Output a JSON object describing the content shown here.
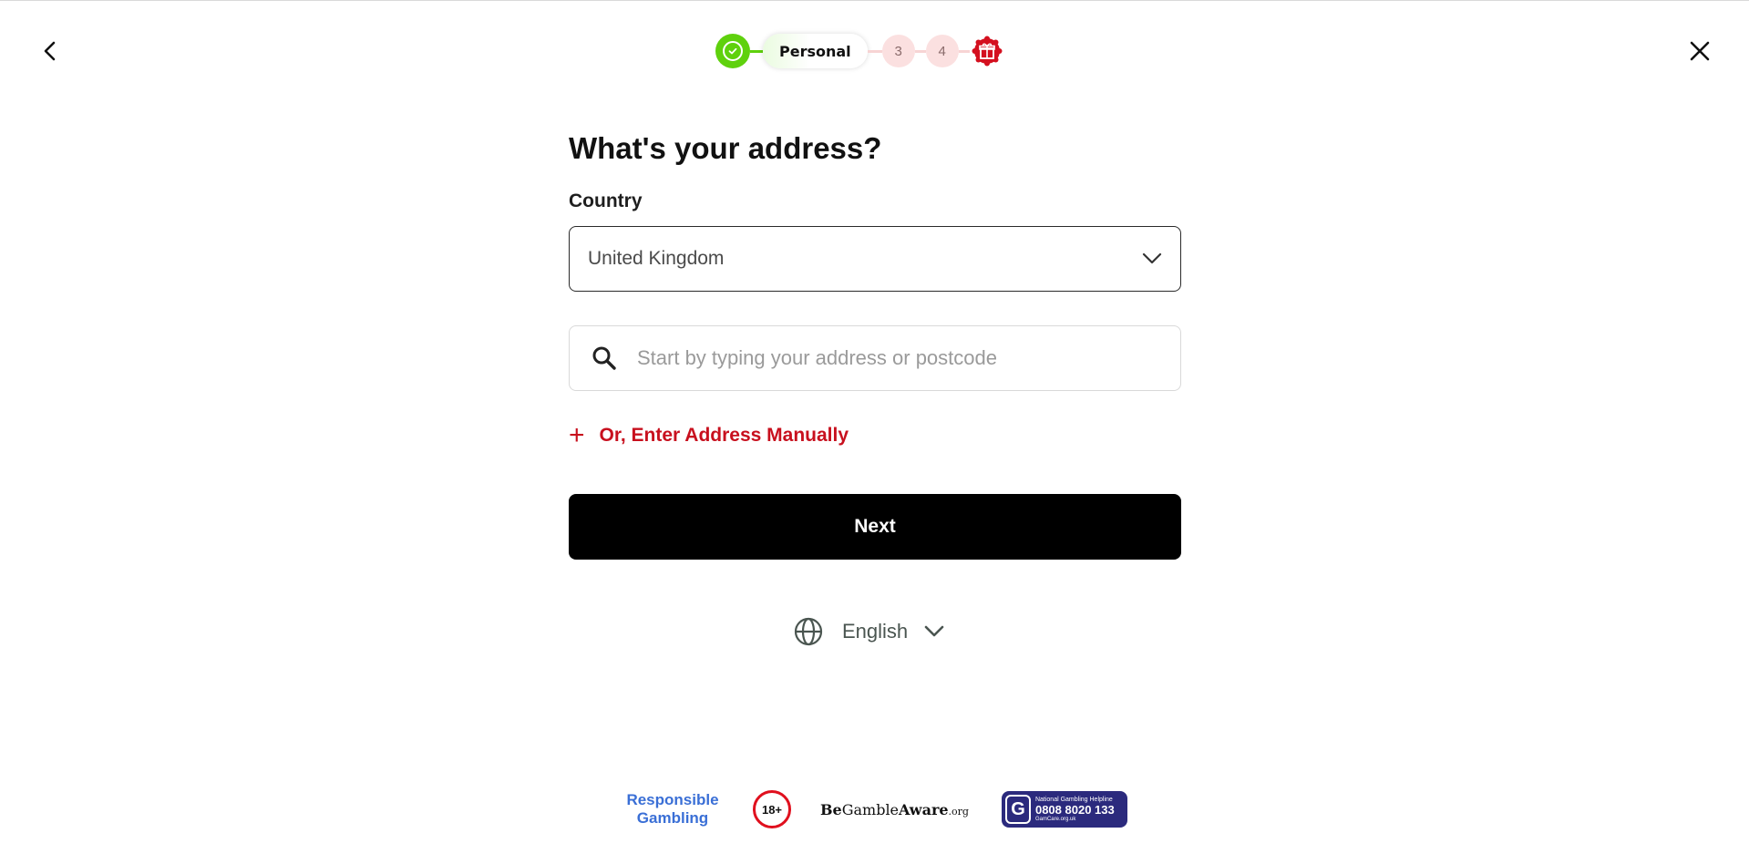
{
  "stepper": {
    "completed_icon": "check-icon",
    "current_label": "Personal",
    "steps": [
      "3",
      "4"
    ],
    "reward_icon": "gift-icon"
  },
  "nav": {
    "back_icon": "chevron-left-icon",
    "close_icon": "close-icon"
  },
  "form": {
    "heading": "What's your address?",
    "country_label": "Country",
    "country_value": "United Kingdom",
    "address_placeholder": "Start by typing your address or postcode",
    "manual_link_icon": "+",
    "manual_link_label": "Or, Enter Address Manually",
    "next_label": "Next"
  },
  "language": {
    "icon": "globe-icon",
    "label": "English"
  },
  "footer": {
    "responsible_gambling_line1": "Responsible",
    "responsible_gambling_line2": "Gambling",
    "age_badge": "18+",
    "begambleaware_be": "Be",
    "begambleaware_gamble": "Gamble",
    "begambleaware_aware": "Aware",
    "begambleaware_org": ".org",
    "helpline_logo": "G",
    "helpline_title": "National Gambling Helpline",
    "helpline_number": "0808 8020 133",
    "helpline_site": "GamCare.org.uk"
  },
  "colors": {
    "success": "#5fd10d",
    "accent_red": "#c8101e",
    "primary_button": "#000000",
    "step_inactive": "#fbe0e0",
    "helpline_bg": "#2b2a7d"
  }
}
